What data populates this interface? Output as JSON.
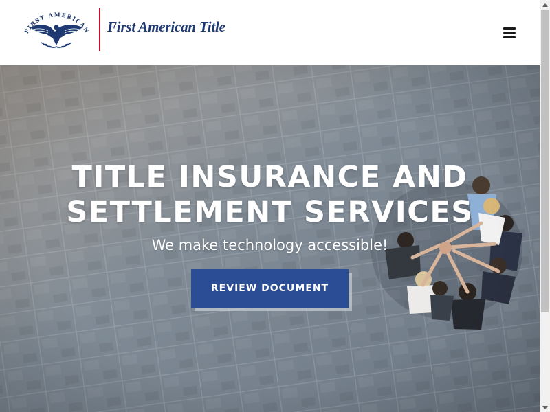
{
  "header": {
    "logo_ring_text": "FIRST AMERICAN",
    "brand_name": "First American Title",
    "brand_color": "#1f3a73",
    "divider_color": "#c8102e",
    "menu_icon": "hamburger-menu-icon"
  },
  "hero": {
    "title_line1": "TITLE INSURANCE AND",
    "title_line2": "SETTLEMENT SERVICES",
    "subtitle": "We make technology accessible!",
    "cta_label": "REVIEW DOCUMENT",
    "cta_color": "#2a4d96",
    "background": "aerial-photo-team-hands-together-on-stone-floor"
  },
  "scrollbar": {
    "up_icon": "scroll-up-arrow-icon",
    "down_icon": "scroll-down-arrow-icon"
  }
}
